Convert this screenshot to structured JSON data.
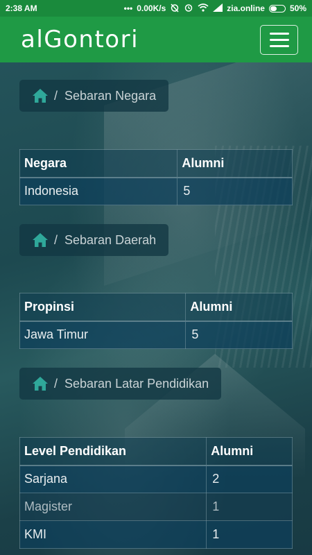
{
  "status_bar": {
    "time": "2:38 AM",
    "network_speed": "0.00K/s",
    "carrier": "zia.online",
    "battery": "50%",
    "battery_level": 0.5,
    "icons": [
      "more-dots-icon",
      "alarm-off-icon",
      "alarm-icon",
      "wifi-icon",
      "signal-icon",
      "battery-icon"
    ]
  },
  "header": {
    "brand": "alGontori",
    "menu_icon": "hamburger-menu-icon",
    "background_color": "#1f9a45"
  },
  "sections": [
    {
      "breadcrumb": {
        "icon": "home-icon",
        "separator": "/",
        "label": "Sebaran Negara"
      },
      "table": {
        "columns": [
          "Negara",
          "Alumni"
        ],
        "rows": [
          [
            "Indonesia",
            "5"
          ]
        ]
      }
    },
    {
      "breadcrumb": {
        "icon": "home-icon",
        "separator": "/",
        "label": "Sebaran Daerah"
      },
      "table": {
        "columns": [
          "Propinsi",
          "Alumni"
        ],
        "rows": [
          [
            "Jawa Timur",
            "5"
          ]
        ]
      }
    },
    {
      "breadcrumb": {
        "icon": "home-icon",
        "separator": "/",
        "label": "Sebaran Latar Pendidikan"
      },
      "table": {
        "columns": [
          "Level Pendidikan",
          "Alumni"
        ],
        "rows": [
          [
            "Sarjana",
            "2"
          ],
          [
            "Magister",
            "1"
          ],
          [
            "KMI",
            "1"
          ]
        ]
      }
    }
  ],
  "colors": {
    "accent": "#1f9a45",
    "home_icon": "#2fa89a",
    "table_cell": "#0c3e5a"
  }
}
